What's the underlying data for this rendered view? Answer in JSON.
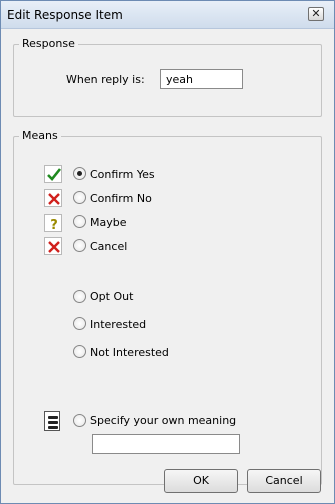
{
  "window": {
    "title": "Edit Response Item",
    "close_glyph": "✕"
  },
  "response_group": {
    "legend": "Response",
    "reply_label": "When reply is:",
    "reply_value": "yeah"
  },
  "means_group": {
    "legend": "Means",
    "options": [
      {
        "label": "Confirm Yes",
        "selected": true,
        "icon": "check-icon"
      },
      {
        "label": "Confirm No",
        "selected": false,
        "icon": "x-icon"
      },
      {
        "label": "Maybe",
        "selected": false,
        "icon": "question-icon"
      },
      {
        "label": "Cancel",
        "selected": false,
        "icon": "x-icon"
      },
      {
        "label": "Opt Out",
        "selected": false
      },
      {
        "label": "Interested",
        "selected": false
      },
      {
        "label": "Not Interested",
        "selected": false
      },
      {
        "label": "Specify your own meaning",
        "selected": false,
        "icon": "custom-meaning-icon"
      }
    ],
    "custom_meaning_value": ""
  },
  "buttons": {
    "ok": "OK",
    "cancel": "Cancel"
  },
  "colors": {
    "check": "#1f8a1f",
    "cross": "#d0201c",
    "question": "#9a8a00"
  }
}
